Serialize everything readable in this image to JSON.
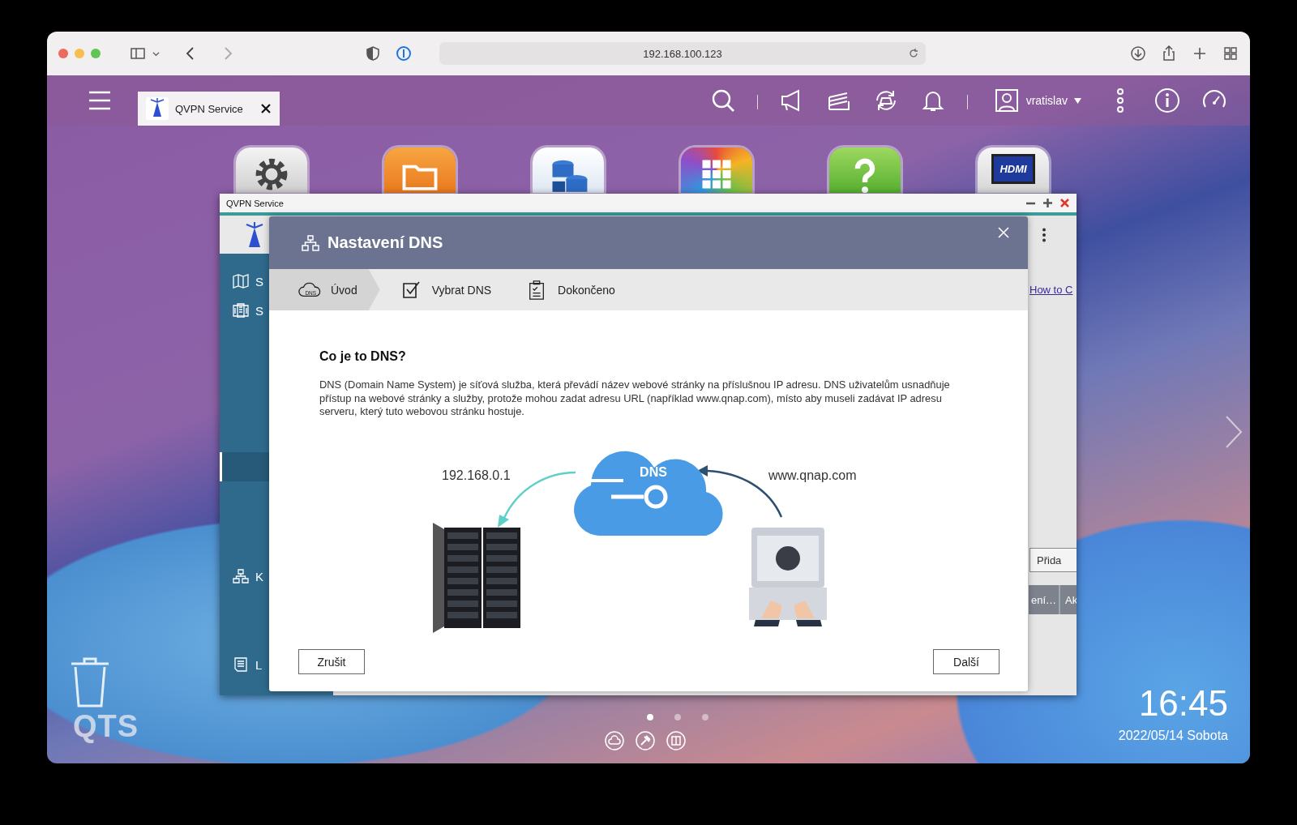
{
  "browser": {
    "url": "192.168.100.123"
  },
  "taskbar": {
    "tab": {
      "label": "QVPN Service"
    },
    "user": "vratislav"
  },
  "desktop_apps": [
    {
      "kind": "settings"
    },
    {
      "kind": "folder"
    },
    {
      "kind": "storage"
    },
    {
      "kind": "apps"
    },
    {
      "kind": "help"
    },
    {
      "kind": "hdmi",
      "label": "HDMI"
    }
  ],
  "window": {
    "title": "QVPN Service",
    "sidebar": [
      {
        "kind": "map",
        "label": "S",
        "selected": false
      },
      {
        "kind": "servers",
        "label": "S",
        "selected": false
      },
      {
        "kind": "blank",
        "selected": true
      },
      {
        "kind": "network",
        "label": "K",
        "selected": false
      },
      {
        "kind": "document",
        "label": "L",
        "selected": false
      }
    ],
    "link": "How to C",
    "add_button": "Přida",
    "table_columns": [
      "ení…",
      "Ak"
    ]
  },
  "dialog": {
    "title": "Nastavení DNS",
    "steps": [
      {
        "kind": "dns",
        "icon_text": "DNS",
        "label": "Úvod",
        "selected": true
      },
      {
        "kind": "check",
        "label": "Vybrat DNS",
        "selected": false
      },
      {
        "kind": "clipboard",
        "label": "Dokončeno",
        "selected": false
      }
    ],
    "heading": "Co je to DNS?",
    "text": "DNS (Domain Name System) je síťová služba, která převádí název webové stránky na příslušnou IP adresu. DNS uživatelům usnadňuje přístup na webové stránky a služby, protože mohou zadat adresu URL (například www.qnap.com), místo aby museli zadávat IP adresu serveru, který tuto webovou stránku hostuje.",
    "diagram": {
      "left_label": "192.168.0.1",
      "cloud_label": "DNS",
      "right_label": "www.qnap.com"
    },
    "buttons": [
      {
        "label": "Zrušit"
      },
      {
        "label": "Další"
      }
    ]
  },
  "pager": [
    {
      "selected": true
    },
    {
      "selected": false
    },
    {
      "selected": false
    }
  ],
  "logo": "QTS",
  "clock": {
    "time": "16:45",
    "date": "2022/05/14 Sobota"
  }
}
